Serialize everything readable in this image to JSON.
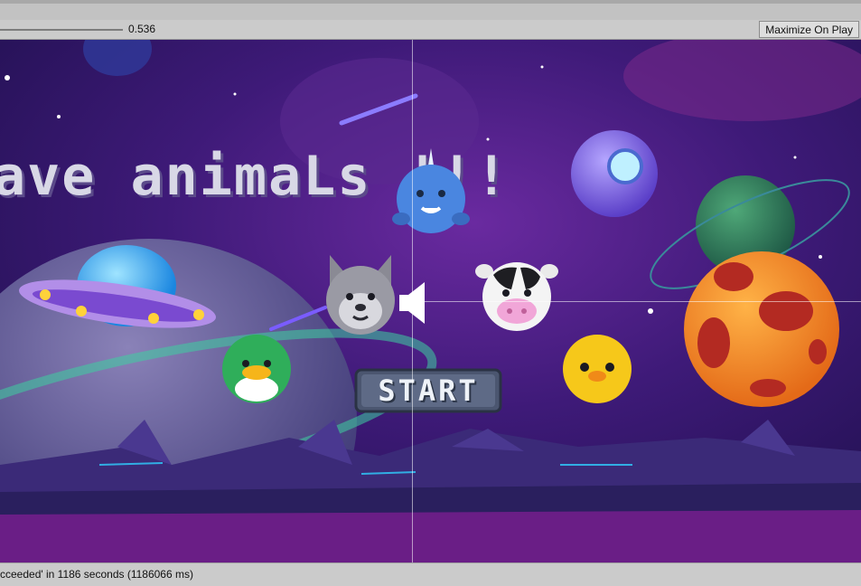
{
  "toolbar": {
    "scale_value": "0.536",
    "maximize_label": "Maximize On Play"
  },
  "game": {
    "title": "ave animaLs !!!",
    "start_label": "START",
    "animals": [
      "narwhal",
      "wolf",
      "cow",
      "duck",
      "chick"
    ],
    "icons": [
      "ufo-icon",
      "speaker-icon",
      "planet-icon"
    ]
  },
  "status": {
    "message": "cceeded' in 1186 seconds (1186066 ms)"
  },
  "colors": {
    "space_bg": "#3a1a6e",
    "ground": "#5a2a8a",
    "orange_planet": "#f08a28",
    "green_planet": "#2f7a5a",
    "start_button": "#4b5670"
  }
}
